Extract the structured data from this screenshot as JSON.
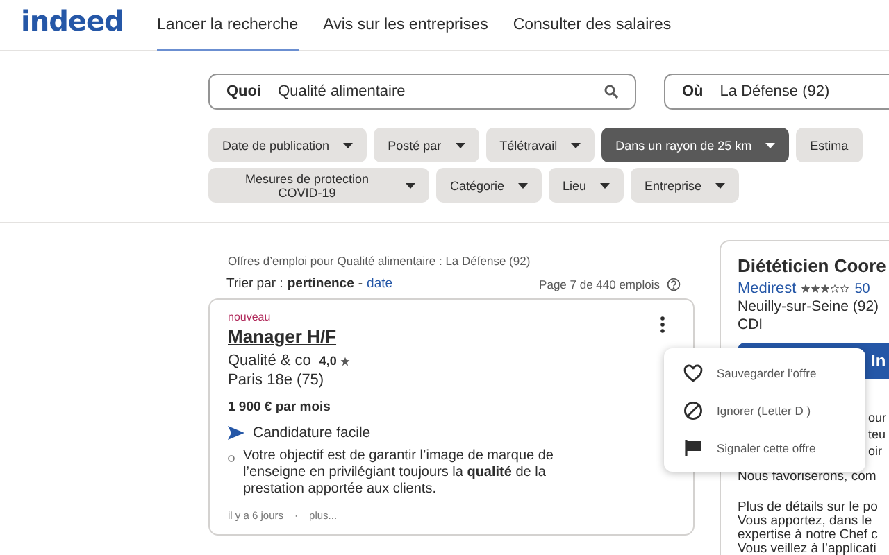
{
  "logo": "indeed",
  "nav": [
    {
      "label": "Lancer la recherche",
      "selected": true
    },
    {
      "label": "Avis sur les entreprises",
      "selected": false
    },
    {
      "label": "Consulter des salaires",
      "selected": false
    }
  ],
  "search": {
    "what": {
      "label": "Quoi",
      "value": "Qualité alimentaire"
    },
    "where": {
      "label": "Où",
      "value": "La Défense (92)"
    }
  },
  "filter_rows": [
    [
      {
        "label": "Date de publication",
        "active": false,
        "caret": true
      },
      {
        "label": "Posté par",
        "active": false,
        "caret": true
      },
      {
        "label": "Télétravail",
        "active": false,
        "caret": true
      },
      {
        "label": "Dans un rayon de 25 km",
        "active": true,
        "caret": true
      },
      {
        "label": "Estima",
        "active": false,
        "caret": false
      }
    ],
    [
      {
        "label": "Mesures de protection COVID-19",
        "active": false,
        "caret": true
      },
      {
        "label": "Catégorie",
        "active": false,
        "caret": true
      },
      {
        "label": "Lieu",
        "active": false,
        "caret": true
      },
      {
        "label": "Entreprise",
        "active": false,
        "caret": true
      }
    ]
  ],
  "results": {
    "heading": "Offres d’emploi pour Qualité alimentaire : La Défense (92)",
    "sort_label": "Trier par :",
    "sort_options": [
      {
        "label": "pertinence",
        "selected": true
      },
      {
        "label": "date",
        "selected": false
      }
    ],
    "separator": "-",
    "page_info": "Page 7 de 440 emplois"
  },
  "job": {
    "badge": "nouveau",
    "title": "Manager H/F",
    "company": "Qualité & co",
    "rating": "4,0",
    "location": "Paris 18e (75)",
    "salary": "1 900 € par mois",
    "easy_apply": "Candidature facile",
    "snippet": "Votre objectif est de garantir l’image de marque de l’enseigne en privilégiant toujours la **qualité** de la prestation apportée aux clients.",
    "date": "il y a 6 jours",
    "dot": "·",
    "more": "plus..."
  },
  "menu": [
    {
      "kind": "save",
      "label": "Sauvegarder l’offre"
    },
    {
      "kind": "ignore",
      "label": "Ignorer (Letter D )"
    },
    {
      "kind": "report",
      "label": "Signaler cette offre"
    }
  ],
  "detail": {
    "title": "Diététicien Coore",
    "company": "Medirest",
    "stars": 3,
    "reviews": "50",
    "location": "Neuilly-sur-Seine (92)",
    "contract": "CDI",
    "apply_label": "In",
    "fragments": [
      "our",
      "teu",
      "oir"
    ],
    "paragraphs": [
      [
        "Nous favoriserons, com"
      ],
      [
        "Plus de détails sur le po",
        "Vous apportez, dans le",
        "expertise à notre Chef c",
        "Vous veillez à l’applicati"
      ]
    ]
  }
}
